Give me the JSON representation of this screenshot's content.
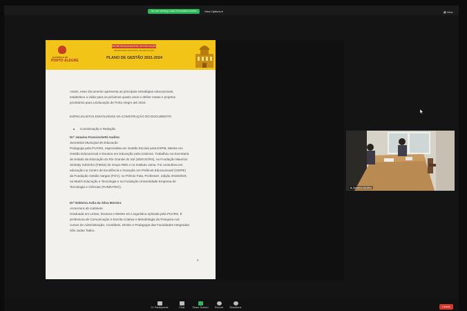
{
  "top_bar": {
    "share_notice": "You are viewing Lucas Fernandes's screen",
    "view_options": "View Options",
    "view_button": "View"
  },
  "document": {
    "header": {
      "logo_line1": "prefeitura de",
      "logo_line2": "PORTO ALEGRE",
      "red_box": "SECRETARIA MUNICIPAL DE EDUCAÇÃO",
      "sub_box": "SECRETARIA MUNICIPAL DE EDUCAÇÃO",
      "title": "PLANO DE GESTÃO 2021-2024"
    },
    "intro_lines": [
      "Assim, esse documento apresenta as principais estratégias educacionais,",
      "estabelece a visão para os próximos quatro anos e define metas e projetos",
      "prioritários para a Educação de Porto Alegre até 2024."
    ],
    "section_title": "ESPECIALISTAS ENVOLVIDOS NA CONSTRUÇÃO DO DOCUMENTO",
    "bullet": "Coordenação e Redação",
    "person1": {
      "name": "Drª Janaina Francischetti Audino",
      "role": "Secretária Municipal de Educação",
      "bio_lines": [
        "Pedagoga pela PUCRS, especialista em Gestão Escolar pela ESPM, Mestre em",
        "Gestão Educacional e Doutora em Educação pela Unisinos. Trabalhou na Secretaria",
        "de Estado da Educação do Rio Grande do Sul (SEDUC/RS), na Fundação Maurício",
        "Sirotsky Sobrinho (FMSS) do Grupo RBS e no Instituto Jama. Foi consultora em",
        "educação no Centro de Excelência e Inovação em Políticas Educacionais (CEIPE)",
        "da Fundação Getúlio Vargas (FGV), no Prêmio Fata, Professor!, edição 2018/2019,",
        "na Match Educação e Tecnologia e na Fundação Universidade Empresa de",
        "Tecnologia e Ciências (FUNDATEC)."
      ]
    },
    "person2": {
      "name": "Drª Edelvira Avila da Silva Moreira",
      "role": "Assessora do Gabinete",
      "bio_lines": [
        "Graduada em Letras, Doutora e Mestre em Linguística Aplicada pela PUCRS. É",
        "professora de Comunicação e Escrita Criativa e Metodologia da Pesquisa nos",
        "cursos de Administração, Contábeis, Direito e Pedagogia das Faculdades Integradas",
        "São Judas Tadeu."
      ]
    },
    "page_number": "4"
  },
  "video": {
    "participant_name": "Janaina Audino"
  },
  "toolbar": {
    "participants_label": "Participants",
    "participants_count": "21",
    "chat_label": "Chat",
    "share_label": "Share Screen",
    "record_label": "Record",
    "reactions_label": "Reactions",
    "leave_label": "Leave"
  }
}
